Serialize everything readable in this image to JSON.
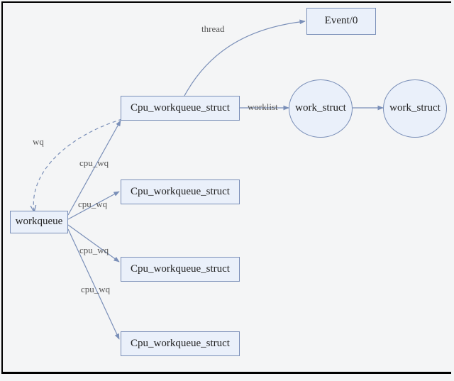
{
  "nodes": {
    "workqueue": "workqueue",
    "cpu_wq_1": "Cpu_workqueue_struct",
    "cpu_wq_2": "Cpu_workqueue_struct",
    "cpu_wq_3": "Cpu_workqueue_struct",
    "cpu_wq_4": "Cpu_workqueue_struct",
    "event0": "Event/0",
    "work_struct_1": "work_struct",
    "work_struct_2": "work_struct"
  },
  "edges": {
    "wq": "wq",
    "cpu_wq_a": "cpu_wq",
    "cpu_wq_b": "cpu_wq",
    "cpu_wq_c": "cpu_wq",
    "cpu_wq_d": "cpu_wq",
    "thread": "thread",
    "worklist": "worklist"
  }
}
